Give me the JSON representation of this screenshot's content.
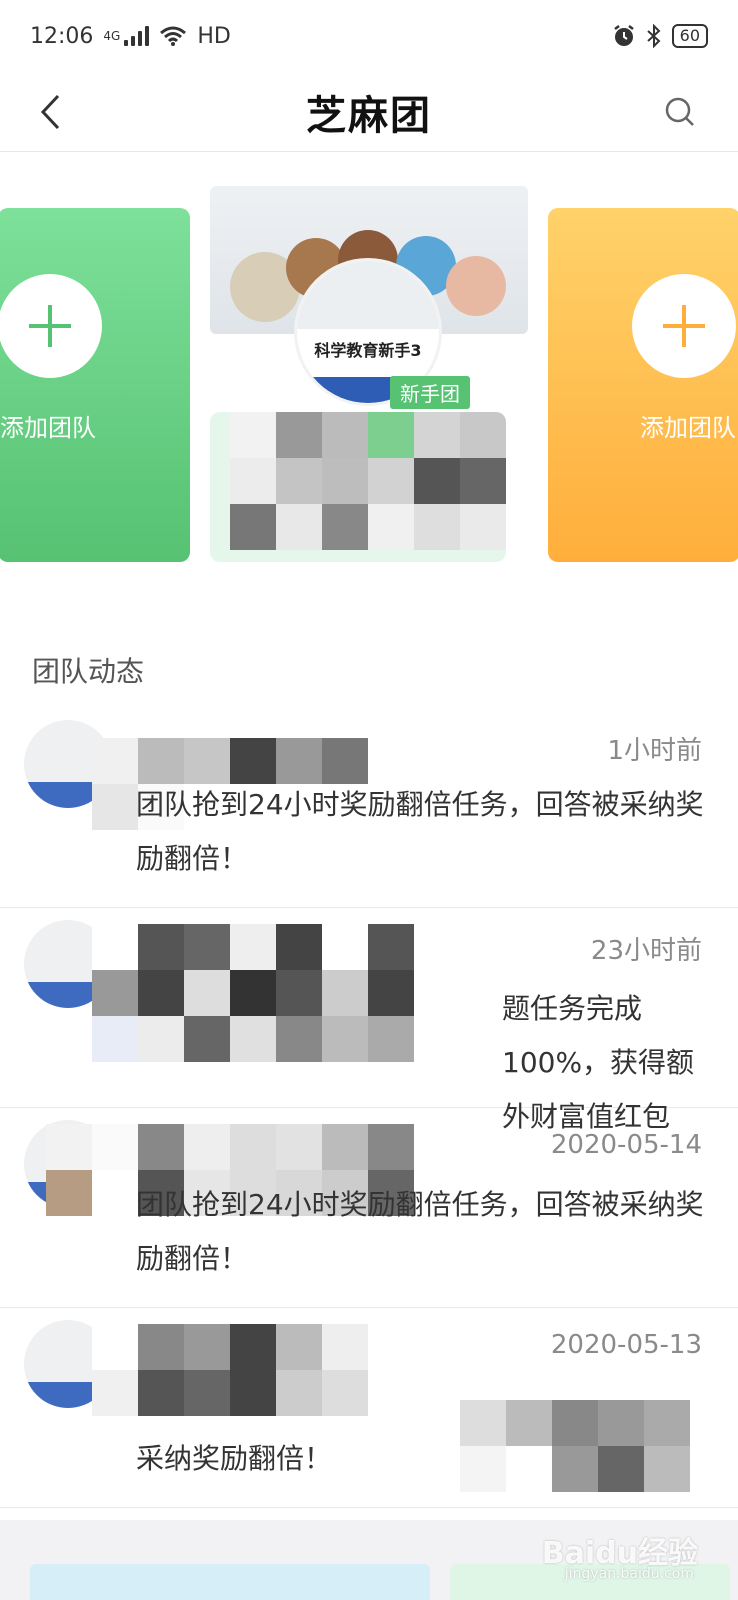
{
  "status_bar": {
    "time": "12:06",
    "network": "4G",
    "hd": "HD",
    "battery": "60",
    "icons": [
      "signal-icon",
      "wifi-icon",
      "alarm-icon",
      "bluetooth-icon",
      "battery-icon"
    ]
  },
  "header": {
    "title": "芝麻团",
    "back_icon": "chevron-left-icon",
    "search_icon": "search-icon"
  },
  "carousel": {
    "left_card": {
      "label": "添加团队",
      "color": "#5cc878"
    },
    "featured_team": {
      "avatar_text": "科学教育新手3",
      "tag": "新手团"
    },
    "right_card": {
      "label": "添加团队",
      "color": "#ffb446"
    }
  },
  "section": {
    "title": "团队动态"
  },
  "feed": [
    {
      "time": "1小时前",
      "message": "团队抢到24小时奖励翻倍任务，回答被采纳奖励翻倍！"
    },
    {
      "time": "23小时前",
      "message": "题任务完成100%，获得额外财富值红包"
    },
    {
      "time": "2020-05-14",
      "message": "团队抢到24小时奖励翻倍任务，回答被采纳奖励翻倍！"
    },
    {
      "time": "2020-05-13",
      "message": "采纳奖励翻倍！"
    }
  ],
  "watermark": {
    "brand": "Baidu经验",
    "url": "jingyan.baidu.com"
  },
  "colors": {
    "accent_green": "#56c272",
    "accent_orange": "#ffae3b",
    "badge_blue": "#2e5db6"
  }
}
